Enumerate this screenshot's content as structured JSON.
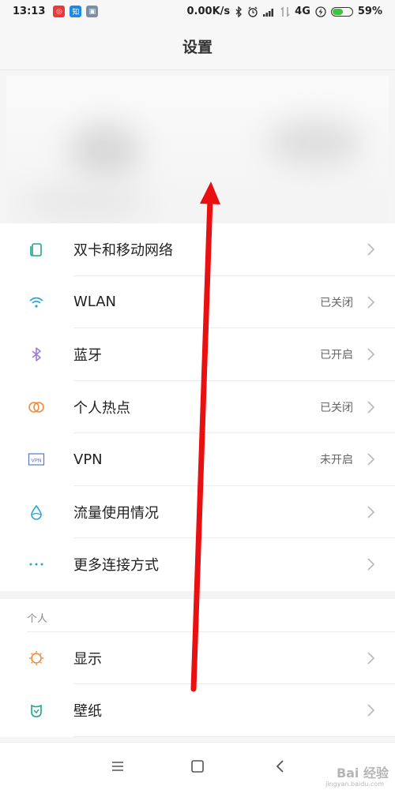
{
  "status_bar": {
    "time": "13:13",
    "notifications": [
      "微博",
      "知",
      "▣"
    ],
    "network_speed": "0.00K/s",
    "network_type": "4G",
    "battery_percent": 59,
    "battery_text": "59%"
  },
  "title": "设置",
  "connectivity": {
    "items": [
      {
        "label": "双卡和移动网络",
        "value": "",
        "icon": "sim-card-icon",
        "color": "#1aa88c"
      },
      {
        "label": "WLAN",
        "value": "已关闭",
        "icon": "wifi-icon",
        "color": "#29a3d9"
      },
      {
        "label": "蓝牙",
        "value": "已开启",
        "icon": "bluetooth-icon",
        "color": "#9b7fd6"
      },
      {
        "label": "个人热点",
        "value": "已关闭",
        "icon": "hotspot-icon",
        "color": "#f08a3c"
      },
      {
        "label": "VPN",
        "value": "未开启",
        "icon": "vpn-icon",
        "color": "#5a78c8"
      },
      {
        "label": "流量使用情况",
        "value": "",
        "icon": "data-usage-icon",
        "color": "#29a3d9"
      },
      {
        "label": "更多连接方式",
        "value": "",
        "icon": "more-icon",
        "color": "#29a3d9"
      }
    ]
  },
  "personal": {
    "header": "个人",
    "items": [
      {
        "label": "显示",
        "value": "",
        "icon": "display-icon",
        "color": "#f08a3c"
      },
      {
        "label": "壁纸",
        "value": "",
        "icon": "wallpaper-icon",
        "color": "#1aa88c"
      }
    ]
  },
  "icons": {
    "vpn_text": "VPN"
  },
  "watermark": {
    "brand": "Bai 经验",
    "url": "jingyan.baidu.com"
  },
  "colors": {
    "accent_red": "#e81010",
    "chevron": "#b8b8b8"
  }
}
